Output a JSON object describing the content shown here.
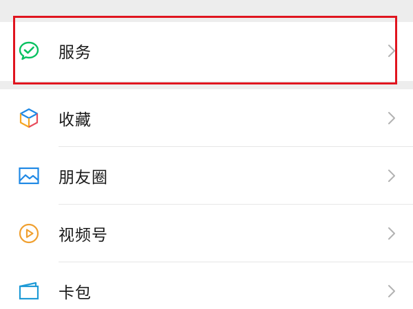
{
  "menu": {
    "items": [
      {
        "label": "服务",
        "icon": "wechat-pay-check-icon",
        "color": "#07c160"
      },
      {
        "label": "收藏",
        "icon": "cube-icon",
        "color": "#f5a623"
      },
      {
        "label": "朋友圈",
        "icon": "picture-icon",
        "color": "#1e88e5"
      },
      {
        "label": "视频号",
        "icon": "play-circle-icon",
        "color": "#f0a030"
      },
      {
        "label": "卡包",
        "icon": "wallet-card-icon",
        "color": "#1e9ad6"
      }
    ]
  },
  "highlight": {
    "color": "#e0141e",
    "target": "服务"
  }
}
